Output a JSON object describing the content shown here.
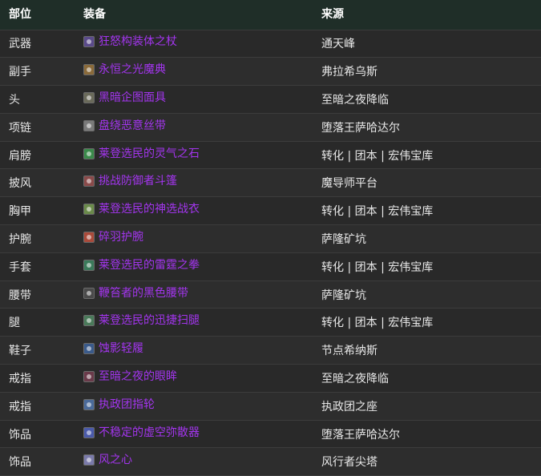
{
  "headers": {
    "slot": "部位",
    "item": "装备",
    "source": "来源"
  },
  "rows": [
    {
      "slot": "武器",
      "item": "狂怒构装体之杖",
      "source": "通天峰",
      "icon": "staff-icon",
      "icon_color": "#5a4a8a"
    },
    {
      "slot": "副手",
      "item": "永恒之光魔典",
      "source": "弗拉希乌斯",
      "icon": "tome-icon",
      "icon_color": "#8a6a3a"
    },
    {
      "slot": "头",
      "item": "黑暗企图面具",
      "source": "至暗之夜降临",
      "icon": "mask-icon",
      "icon_color": "#6a6a5a"
    },
    {
      "slot": "项链",
      "item": "盘绕恶意丝带",
      "source": "堕落王萨哈达尔",
      "icon": "necklace-icon",
      "icon_color": "#7a7a7a"
    },
    {
      "slot": "肩膀",
      "item": "莱登选民的灵气之石",
      "source": "转化 | 团本 | 宏伟宝库",
      "icon": "stone-icon",
      "icon_color": "#3a8a4a"
    },
    {
      "slot": "披风",
      "item": "挑战防御者斗篷",
      "source": "魔导师平台",
      "icon": "cloak-icon",
      "icon_color": "#8a4a4a"
    },
    {
      "slot": "胸甲",
      "item": "莱登选民的神选战衣",
      "source": "转化 | 团本 | 宏伟宝库",
      "icon": "chest-icon",
      "icon_color": "#6a8a4a"
    },
    {
      "slot": "护腕",
      "item": "碎羽护腕",
      "source": "萨隆矿坑",
      "icon": "bracer-icon",
      "icon_color": "#aa4a3a"
    },
    {
      "slot": "手套",
      "item": "莱登选民的雷霆之拳",
      "source": "转化 | 团本 | 宏伟宝库",
      "icon": "gloves-icon",
      "icon_color": "#3a7a5a"
    },
    {
      "slot": "腰带",
      "item": "鞭笞者的黑色腰带",
      "source": "萨隆矿坑",
      "icon": "belt-icon",
      "icon_color": "#4a4a4a"
    },
    {
      "slot": "腿",
      "item": "莱登选民的迅捷扫腿",
      "source": "转化 | 团本 | 宏伟宝库",
      "icon": "legs-icon",
      "icon_color": "#4a7a5a"
    },
    {
      "slot": "鞋子",
      "item": "蚀影轻履",
      "source": "节点希纳斯",
      "icon": "boots-icon",
      "icon_color": "#3a5a8a"
    },
    {
      "slot": "戒指",
      "item": "至暗之夜的眼眸",
      "source": "至暗之夜降临",
      "icon": "ring-icon",
      "icon_color": "#6a3a4a"
    },
    {
      "slot": "戒指",
      "item": "执政团指轮",
      "source": "执政团之座",
      "icon": "ring-icon",
      "icon_color": "#4a6a9a"
    },
    {
      "slot": "饰品",
      "item": "不稳定的虚空弥散器",
      "source": "堕落王萨哈达尔",
      "icon": "trinket-icon",
      "icon_color": "#4a5aaa"
    },
    {
      "slot": "饰品",
      "item": "风之心",
      "source": "风行者尖塔",
      "icon": "trinket-icon",
      "icon_color": "#7a7aaa"
    }
  ],
  "colors": {
    "item_quality": "#a335ee",
    "header_bg": "#1f2e28",
    "text": "#e8e8e8"
  }
}
